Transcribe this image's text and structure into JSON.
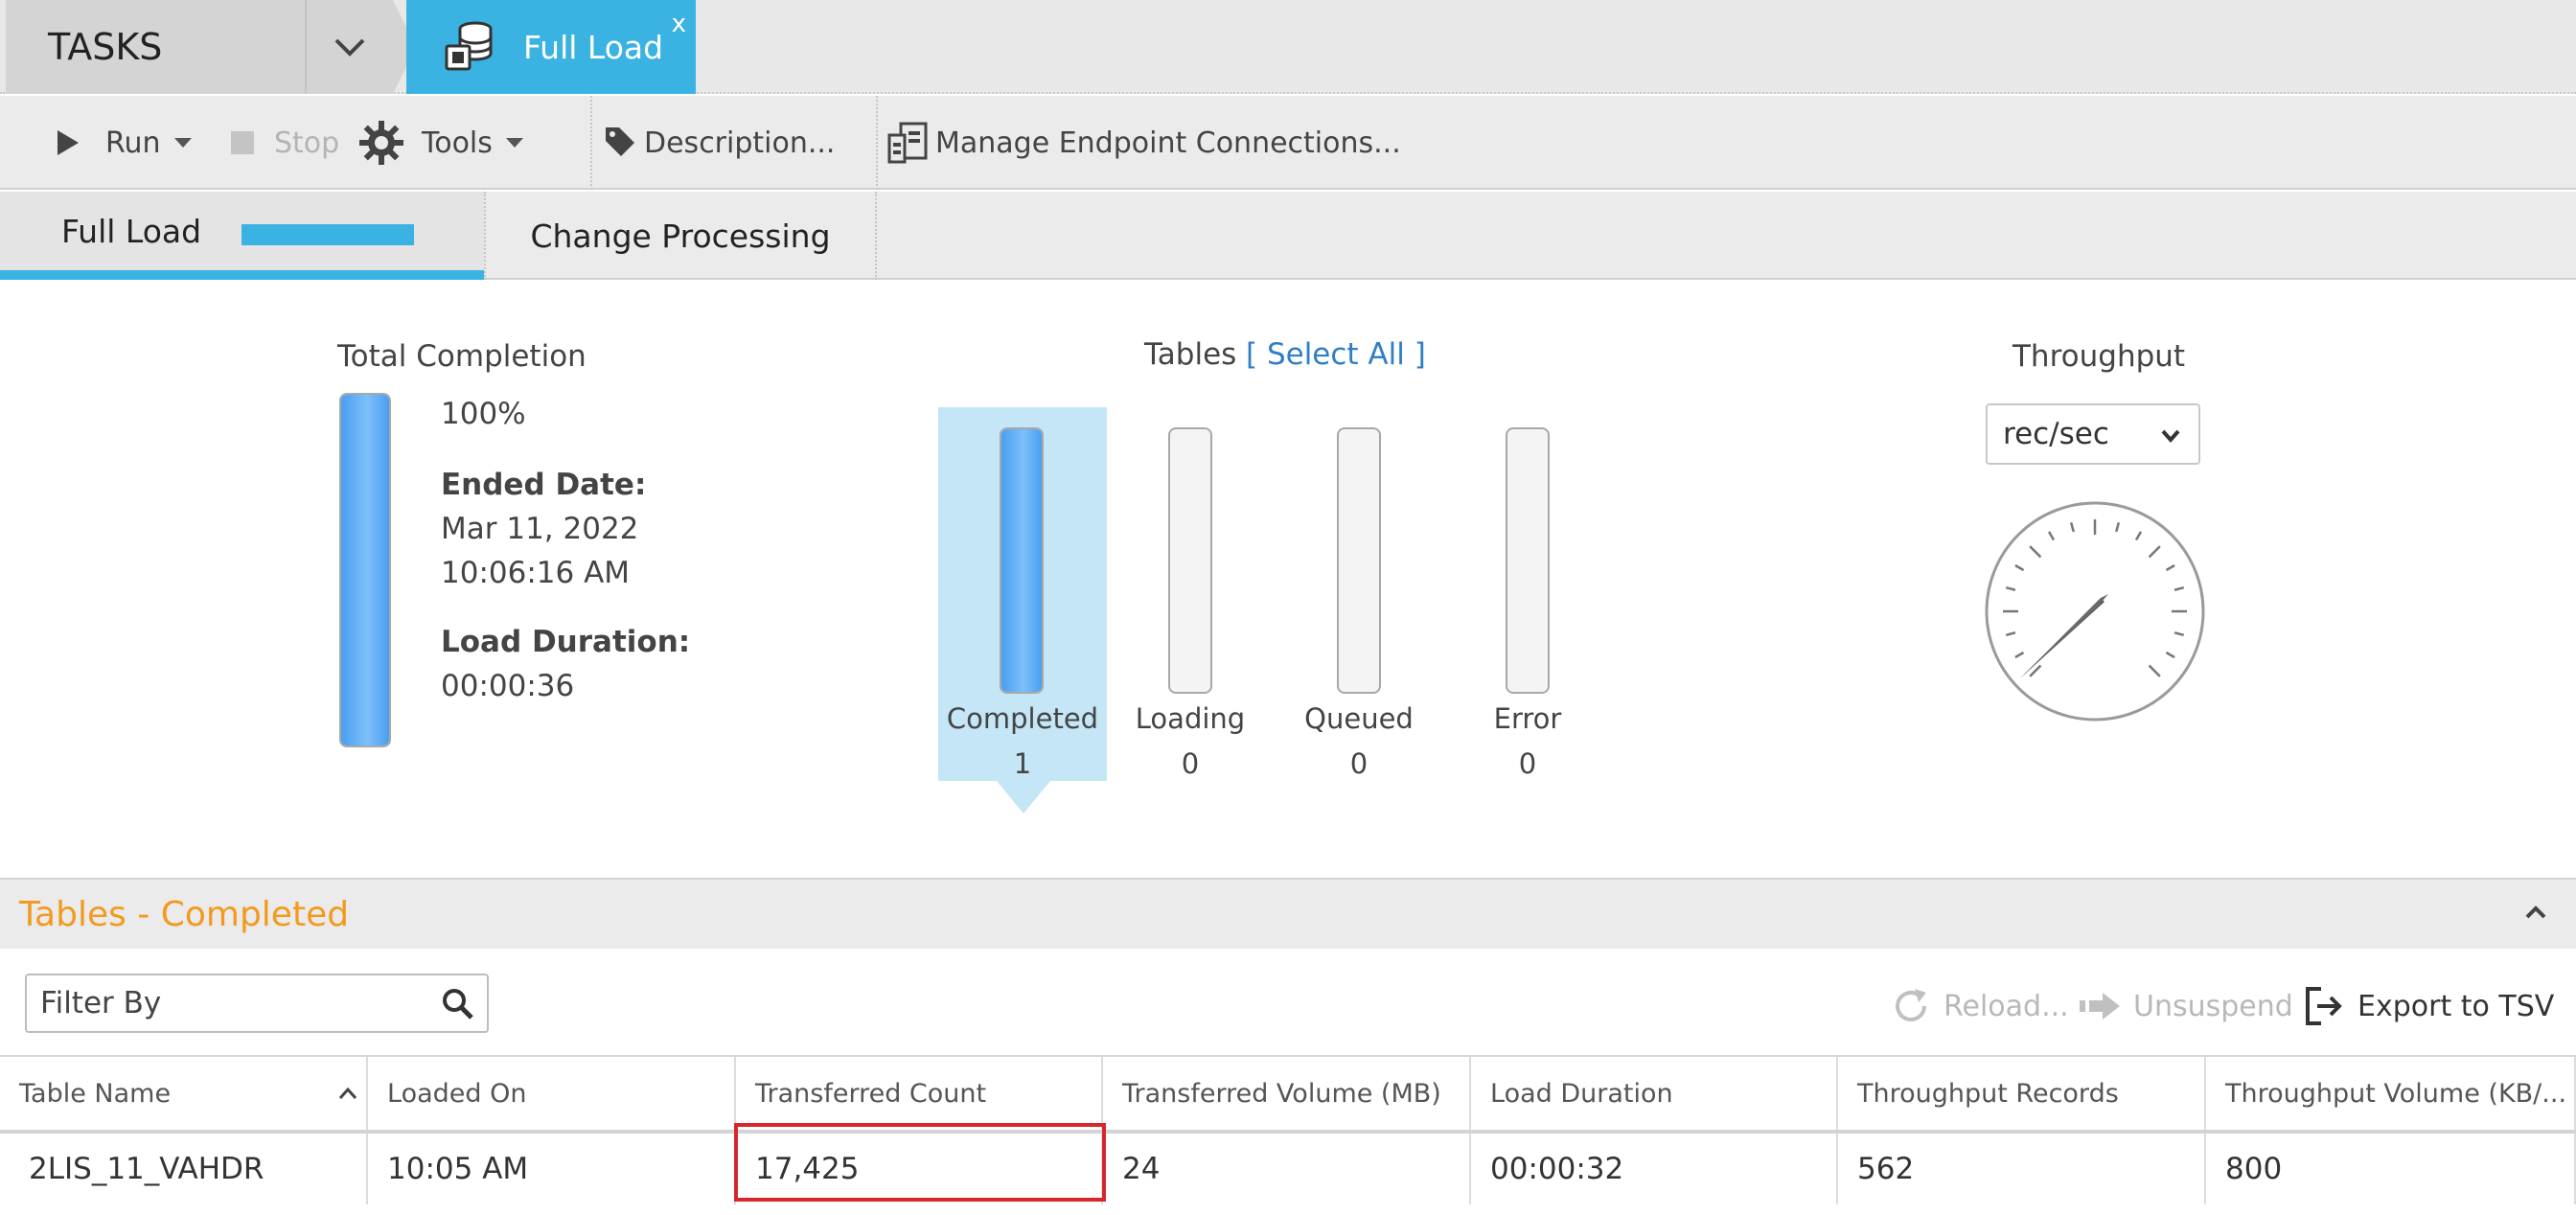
{
  "topbar": {
    "tasks_label": "TASKS",
    "active_tab": "Full Load",
    "close_label": "x"
  },
  "toolbar": {
    "run": "Run",
    "stop": "Stop",
    "tools": "Tools",
    "description": "Description...",
    "manage_endpoints": "Manage Endpoint Connections..."
  },
  "subtabs": {
    "full_load": "Full Load",
    "full_load_progress": 1.0,
    "change_processing": "Change Processing"
  },
  "completion": {
    "title": "Total Completion",
    "percent": "100%",
    "level": 1.0,
    "ended_label": "Ended Date:",
    "ended_date": "Mar 11, 2022",
    "ended_time": "10:06:16 AM",
    "duration_label": "Load Duration:",
    "duration": "00:00:36"
  },
  "tables": {
    "title": "Tables",
    "select_all": "[ Select All ]",
    "bars": [
      {
        "label": "Completed",
        "count": "1",
        "level": 1.0
      },
      {
        "label": "Loading",
        "count": "0",
        "level": 0
      },
      {
        "label": "Queued",
        "count": "0",
        "level": 0
      },
      {
        "label": "Error",
        "count": "0",
        "level": 0
      }
    ]
  },
  "throughput": {
    "title": "Throughput",
    "unit": "rec/sec"
  },
  "section": {
    "title": "Tables - Completed"
  },
  "filter": {
    "placeholder": "Filter By"
  },
  "actions": {
    "reload": "Reload...",
    "unsuspend": "Unsuspend",
    "export": "Export to TSV"
  },
  "grid": {
    "columns": [
      "Table Name",
      "Loaded On",
      "Transferred Count",
      "Transferred Volume (MB)",
      "Load Duration",
      "Throughput Records",
      "Throughput Volume (KB/..."
    ],
    "rows": [
      [
        "2LIS_11_VAHDR",
        "10:05 AM",
        "17,425",
        "24",
        "00:00:32",
        "562",
        "800"
      ]
    ]
  },
  "colors": {
    "accent": "#3ab3e3",
    "section_title": "#f39a1e",
    "highlight": "#d9262c",
    "bar_fill": "#5aaaf4"
  }
}
